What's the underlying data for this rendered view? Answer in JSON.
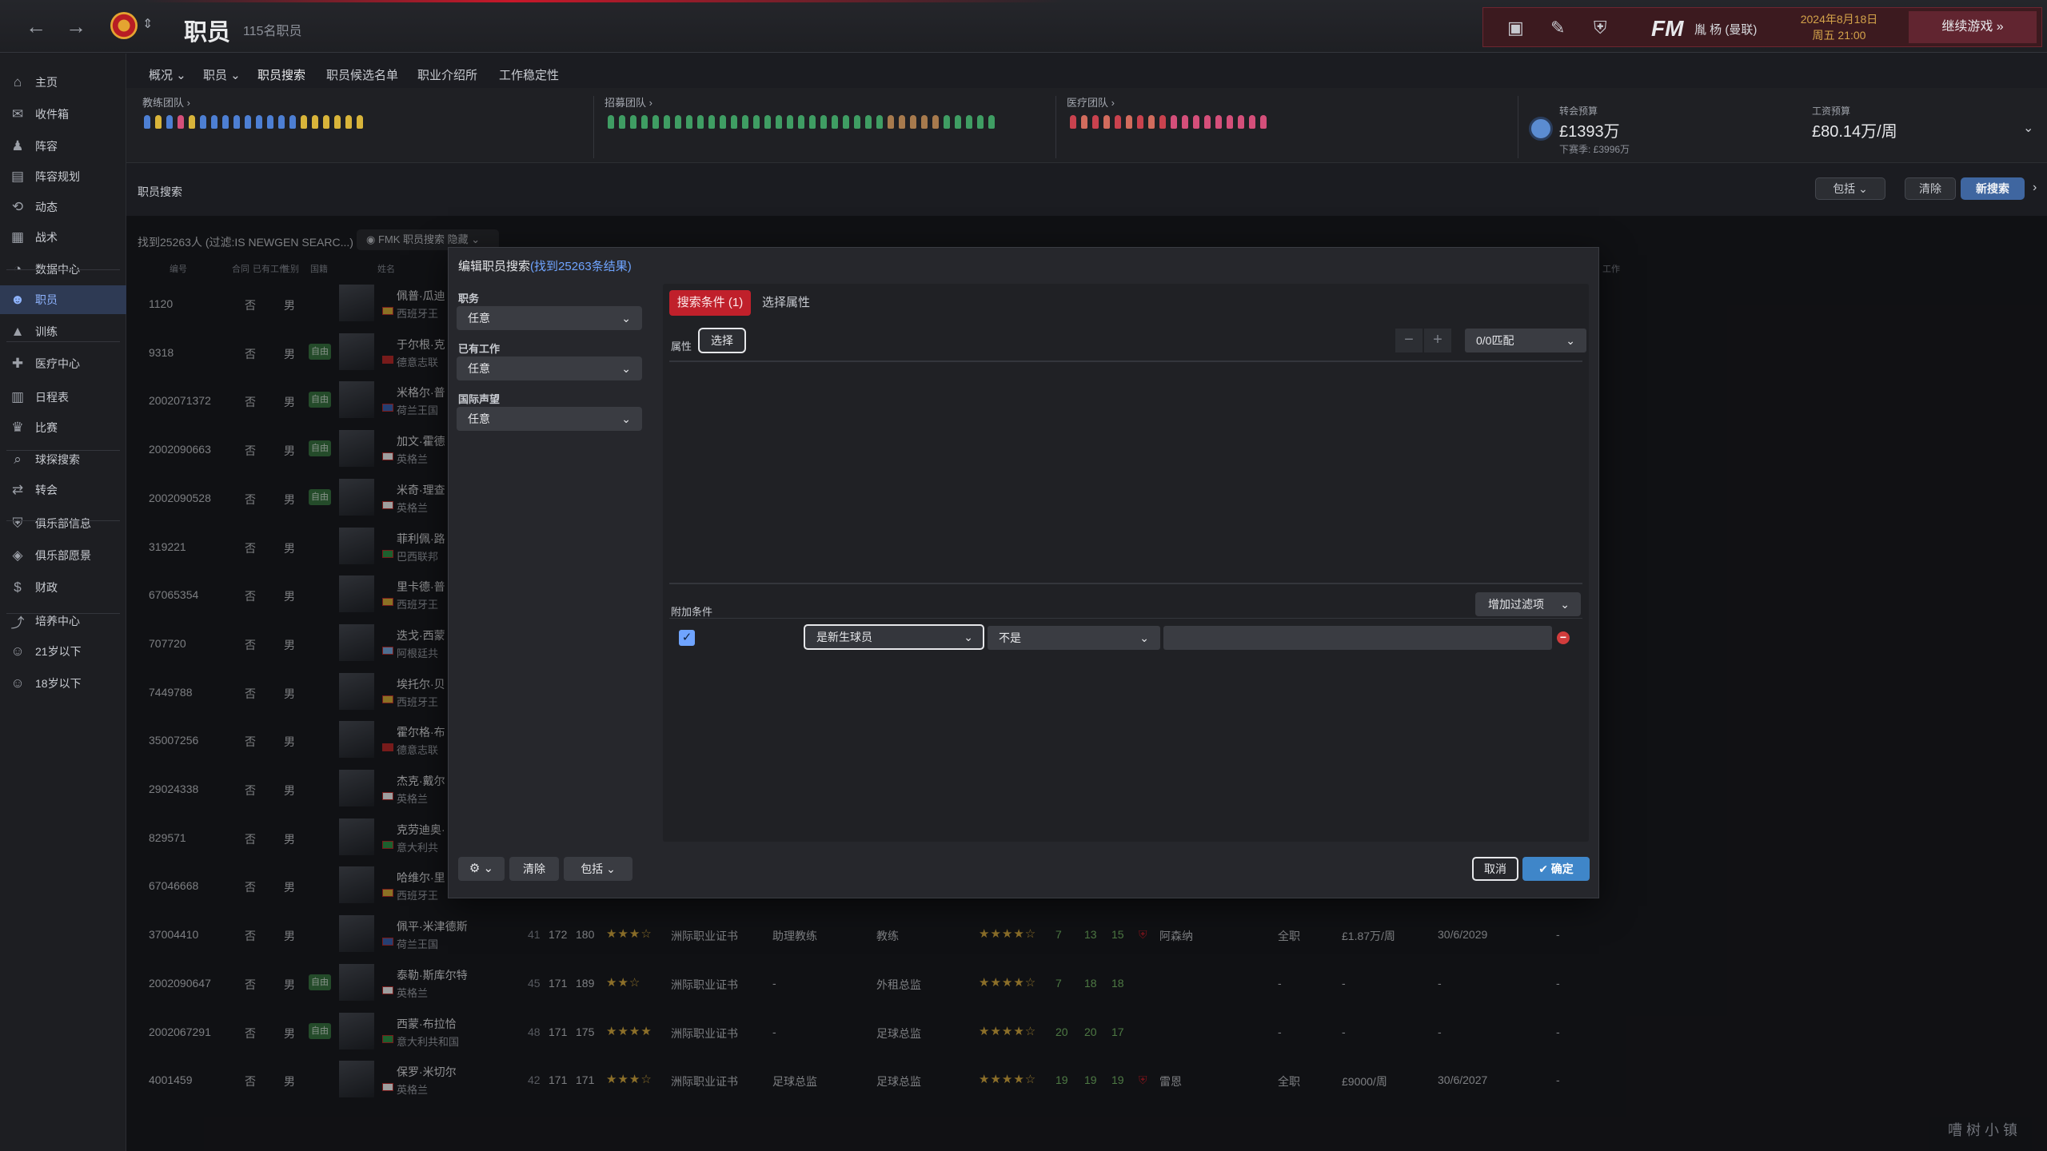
{
  "topbar": {
    "title": "职员",
    "subtitle": "115名职员",
    "user": "胤 杨 (曼联)",
    "date_line1": "2024年8月18日",
    "date_line2": "周五 21:00",
    "continue": "继续游戏",
    "fm": "FM"
  },
  "sidebar": {
    "items": [
      {
        "label": "主页",
        "icon": "home-icon"
      },
      {
        "label": "收件箱",
        "icon": "inbox-icon"
      },
      {
        "label": "阵容",
        "icon": "squad-icon"
      },
      {
        "label": "阵容规划",
        "icon": "planner-icon"
      },
      {
        "label": "动态",
        "icon": "dynamics-icon"
      },
      {
        "label": "战术",
        "icon": "tactics-icon"
      },
      {
        "label": "数据中心",
        "icon": "data-icon"
      },
      {
        "label": "职员",
        "icon": "staff-icon"
      },
      {
        "label": "训练",
        "icon": "training-icon"
      },
      {
        "label": "医疗中心",
        "icon": "medical-icon"
      },
      {
        "label": "日程表",
        "icon": "calendar-icon"
      },
      {
        "label": "比赛",
        "icon": "trophy-icon"
      },
      {
        "label": "球探搜索",
        "icon": "scout-icon"
      },
      {
        "label": "转会",
        "icon": "transfer-icon"
      },
      {
        "label": "俱乐部信息",
        "icon": "club-icon"
      },
      {
        "label": "俱乐部愿景",
        "icon": "vision-icon"
      },
      {
        "label": "财政",
        "icon": "finance-icon"
      },
      {
        "label": "培养中心",
        "icon": "development-icon"
      },
      {
        "label": "21岁以下",
        "icon": "u21-icon"
      },
      {
        "label": "18岁以下",
        "icon": "u18-icon"
      }
    ]
  },
  "subnav": {
    "items": [
      "概况",
      "职员",
      "职员搜索",
      "职员候选名单",
      "职业介绍所",
      "工作稳定性"
    ]
  },
  "teams": {
    "coach": "教练团队",
    "recruit": "招募团队",
    "medical": "医疗团队"
  },
  "finance": {
    "transfer_title": "转会预算",
    "transfer_value": "£1393万",
    "transfer_sub": "下赛季: £3996万",
    "wage_title": "工资预算",
    "wage_value": "£80.14万/周"
  },
  "search": {
    "label": "职员搜索",
    "include": "包括",
    "clear": "清除",
    "new_search": "新搜索",
    "found": "找到25263人 (过滤:IS NEWGEN SEARC...)",
    "filter_chip": "FMK 职员搜索 隐藏"
  },
  "columns": [
    "编号",
    "合同",
    "已有工作",
    "性别",
    "国籍",
    "姓名",
    "工作"
  ],
  "rows": [
    {
      "id": "1120",
      "no": "否",
      "sex": "男",
      "name": "佩普·瓜迪",
      "nat": "西班牙王",
      "badge": ""
    },
    {
      "id": "9318",
      "no": "否",
      "sex": "男",
      "name": "于尔根·克",
      "nat": "德意志联",
      "badge": "自由"
    },
    {
      "id": "2002071372",
      "no": "否",
      "sex": "男",
      "name": "米格尔·普",
      "nat": "荷兰王国",
      "badge": "自由"
    },
    {
      "id": "2002090663",
      "no": "否",
      "sex": "男",
      "name": "加文·霍德",
      "nat": "英格兰",
      "badge": "自由"
    },
    {
      "id": "2002090528",
      "no": "否",
      "sex": "男",
      "name": "米奇·理查",
      "nat": "英格兰",
      "badge": "自由"
    },
    {
      "id": "319221",
      "no": "否",
      "sex": "男",
      "name": "菲利佩·路",
      "nat": "巴西联邦",
      "badge": ""
    },
    {
      "id": "67065354",
      "no": "否",
      "sex": "男",
      "name": "里卡德·普",
      "nat": "西班牙王",
      "badge": ""
    },
    {
      "id": "707720",
      "no": "否",
      "sex": "男",
      "name": "迭戈·西蒙",
      "nat": "阿根廷共",
      "badge": ""
    },
    {
      "id": "7449788",
      "no": "否",
      "sex": "男",
      "name": "埃托尔·贝",
      "nat": "西班牙王",
      "badge": ""
    },
    {
      "id": "35007256",
      "no": "否",
      "sex": "男",
      "name": "霍尔格·布",
      "nat": "德意志联",
      "badge": ""
    },
    {
      "id": "29024338",
      "no": "否",
      "sex": "男",
      "name": "杰克·戴尔",
      "nat": "英格兰",
      "badge": ""
    },
    {
      "id": "829571",
      "no": "否",
      "sex": "男",
      "name": "克劳迪奥·",
      "nat": "意大利共",
      "badge": ""
    },
    {
      "id": "67046668",
      "no": "否",
      "sex": "男",
      "name": "哈维尔·里",
      "nat": "西班牙王",
      "badge": ""
    },
    {
      "id": "37004410",
      "no": "否",
      "sex": "男",
      "name": "佩平·米津德斯",
      "nat": "荷兰王国",
      "badge": "",
      "age": "41",
      "h": "172",
      "w": "180",
      "stars": "★★★☆",
      "lic": "洲际职业证书",
      "r1": "助理教练",
      "r2": "教练",
      "stars2": "★★★★☆",
      "a": "7",
      "b": "13",
      "cc": "15",
      "club": "阿森纳",
      "type": "全职",
      "wage": "£1.87万/周",
      "end": "30/6/2029",
      "last": "-"
    },
    {
      "id": "2002090647",
      "no": "否",
      "sex": "男",
      "name": "泰勒·斯库尔特",
      "nat": "英格兰",
      "badge": "自由",
      "age": "45",
      "h": "171",
      "w": "189",
      "stars": "★★☆",
      "lic": "洲际职业证书",
      "r1": "-",
      "r2": "外租总监",
      "stars2": "★★★★☆",
      "a": "7",
      "b": "18",
      "cc": "18",
      "club": "",
      "type": "-",
      "wage": "-",
      "end": "-",
      "last": "-"
    },
    {
      "id": "2002067291",
      "no": "否",
      "sex": "男",
      "name": "西蒙·布拉恰",
      "nat": "意大利共和国",
      "badge": "自由",
      "age": "48",
      "h": "171",
      "w": "175",
      "stars": "★★★★",
      "lic": "洲际职业证书",
      "r1": "-",
      "r2": "足球总监",
      "stars2": "★★★★☆",
      "a": "20",
      "b": "20",
      "cc": "17",
      "club": "",
      "type": "-",
      "wage": "-",
      "end": "-",
      "last": "-"
    },
    {
      "id": "4001459",
      "no": "否",
      "sex": "男",
      "name": "保罗·米切尔",
      "nat": "英格兰",
      "badge": "",
      "age": "42",
      "h": "171",
      "w": "171",
      "stars": "★★★☆",
      "lic": "洲际职业证书",
      "r1": "足球总监",
      "r2": "足球总监",
      "stars2": "★★★★☆",
      "a": "19",
      "b": "19",
      "cc": "19",
      "club": "雷恩",
      "type": "全职",
      "wage": "£9000/周",
      "end": "30/6/2027",
      "last": "-"
    }
  ],
  "modal": {
    "title": "编辑职员搜索",
    "title_hl": "(找到25263条结果)",
    "field1_label": "职务",
    "field1_value": "任意",
    "field2_label": "已有工作",
    "field2_value": "任意",
    "field3_label": "国际声望",
    "field3_value": "任意",
    "tab_active": "搜索条件 (1)",
    "tab_other": "选择属性",
    "attr_label": "属性",
    "attr_btn": "选择",
    "match": "0/0匹配",
    "minus": "−",
    "plus": "+",
    "add_label": "附加条件",
    "add_filter": "增加过滤项",
    "cond1": "是新生球员",
    "cond2": "不是",
    "include": "包括",
    "clear": "清除",
    "cancel": "取消",
    "ok": "✔ 确定"
  },
  "watermark": "嘈 树 小 镇",
  "colors": {
    "accent_red": "#c0202b",
    "accent_blue": "#3f86c9",
    "star": "#e2b443",
    "link": "#6fa4ff"
  }
}
